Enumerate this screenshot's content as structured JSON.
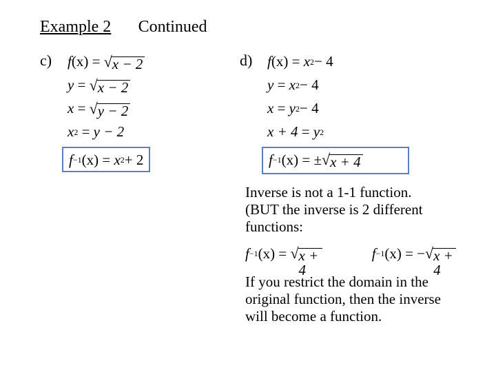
{
  "title": {
    "example": "Example 2",
    "continued": "Continued"
  },
  "c": {
    "label": "c)",
    "l1_fx": "f",
    "l1_x": "(x)",
    "l1_rad": "x − 2",
    "l2_y": "y",
    "l2_rad": "x − 2",
    "l3_x": "x",
    "l3_rad": "y − 2",
    "l4_lhs": "x",
    "l4_exp": "2",
    "l4_rhs": "y − 2",
    "ans_f": "f",
    "ans_exp": "−1",
    "ans_x": "(x)",
    "ans_rhs1": "x",
    "ans_rhs_exp": "2",
    "ans_plus": " + 2"
  },
  "d": {
    "label": "d)",
    "l1_fx": "f",
    "l1_x": "(x)",
    "l1_rhs1": "x",
    "l1_exp": "2",
    "l1_tail": " − 4",
    "l2_y": "y",
    "l2_rhs1": "x",
    "l2_exp": "2",
    "l2_tail": " − 4",
    "l3_x": "x",
    "l3_rhs1": "y",
    "l3_exp": "2",
    "l3_tail": " − 4",
    "l4_lhs": "x + 4",
    "l4_rhs": "y",
    "l4_exp": "2",
    "ans_f": "f",
    "ans_exp": "−1",
    "ans_x": "(x)",
    "ans_pm": "±",
    "ans_rad": "x + 4"
  },
  "note1": "Inverse is not a 1-1 function. (BUT the inverse is 2 different functions:",
  "inv": {
    "a_f": "f",
    "a_exp": "−1",
    "a_x": "(x)",
    "a_rad": "x + 4",
    "b_f": "f",
    "b_exp": "−1",
    "b_x": "(x)",
    "b_neg": "−",
    "b_rad": "x + 4"
  },
  "note2": "If you restrict the domain in the original function, then the inverse will become a function."
}
